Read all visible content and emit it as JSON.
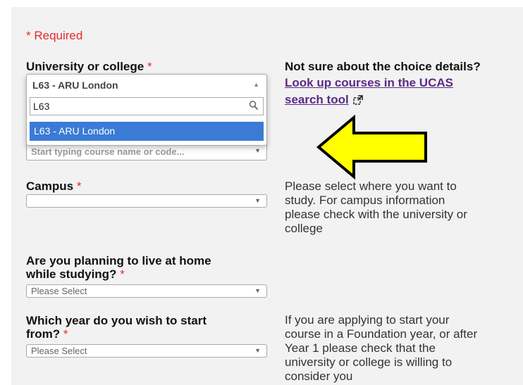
{
  "form": {
    "required_note": "* Required",
    "asterisk": "*",
    "university": {
      "label": "University or college",
      "selected": "L63 - ARU London",
      "search_value": "L63",
      "result": "L63 - ARU London"
    },
    "course": {
      "placeholder": "Start typing course name or code..."
    },
    "campus": {
      "label": "Campus",
      "value": ""
    },
    "live_at_home": {
      "label_line1": "Are you planning to live at home",
      "label_line2": "while studying?",
      "value": "Please Select"
    },
    "start_year": {
      "label_line1": "Which year do you wish to start",
      "label_line2": "from?",
      "value": "Please Select"
    }
  },
  "help": {
    "choice_title": "Not sure about the choice details?",
    "link_line1": "Look up courses in the UCAS",
    "link_line2": "search tool",
    "campus_lines": [
      "Please select where you want to",
      "study. For campus information",
      "please check with the university or",
      "college"
    ],
    "year_lines": [
      "If you are applying to start your",
      "course in a Foundation year, or after",
      "Year 1 please check that the",
      "university or college is willing to",
      "consider you"
    ]
  },
  "annotation": {
    "arrow_color": "#ffff00"
  },
  "icons": {
    "search": "search-icon",
    "external": "external-link-icon",
    "dropdown": "chevron-down-icon"
  }
}
